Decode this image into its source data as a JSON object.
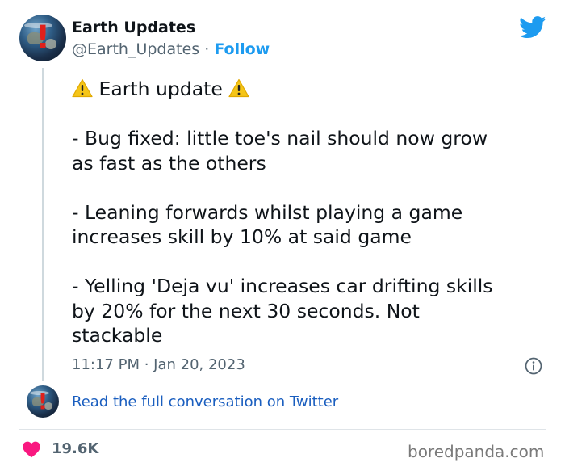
{
  "author": {
    "name": "Earth Updates",
    "handle": "@Earth_Updates",
    "separator": "·",
    "follow_label": "Follow"
  },
  "tweet": {
    "heading": "Earth update",
    "line1": "- Bug fixed: little toe's nail should now grow",
    "line2": "as fast as the others",
    "line3": "- Leaning forwards whilst playing a game",
    "line4": "increases skill by 10% at said game",
    "line5": "- Yelling 'Deja vu' increases car drifting skills",
    "line6": "by 20% for the next 30 seconds. Not",
    "line7": "stackable",
    "timestamp": "11:17 PM · Jan 20, 2023"
  },
  "conversation_link": "Read the full conversation on Twitter",
  "likes": "19.6K",
  "watermark": "boredpanda.com",
  "icons": {
    "avatar": "earth-avatar",
    "brand": "twitter-bird-icon",
    "warning": "warning-sign-icon",
    "info": "info-icon",
    "like": "heart-icon"
  },
  "colors": {
    "link_blue": "#1d9bf0",
    "heart_pink": "#f91880",
    "secondary_text": "#536471",
    "warning_yellow": "#f5c518"
  }
}
